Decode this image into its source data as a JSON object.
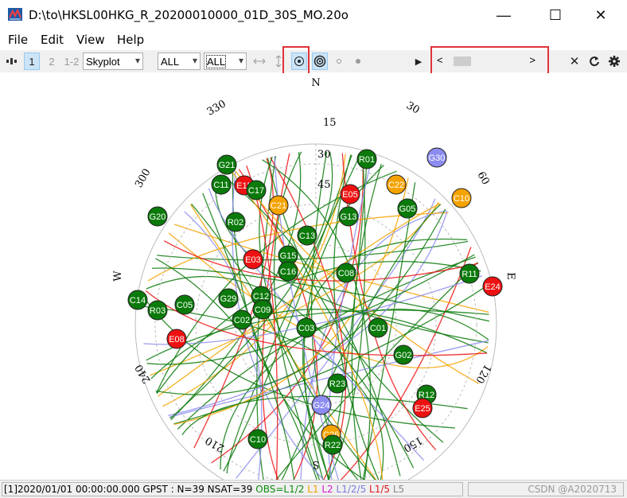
{
  "window": {
    "title": "D:\\to\\HKSL00HKG_R_20200010000_01D_30S_MO.20o",
    "minimize": "—",
    "maximize": "☐",
    "close": "✕"
  },
  "menu": [
    "File",
    "Edit",
    "View",
    "Help"
  ],
  "toolbar": {
    "btn1": "1",
    "btn2": "2",
    "btn12": "1-2",
    "plot_type": "Skyplot",
    "sys_filter": "ALL",
    "sat_filter": "ALL",
    "play": "▶",
    "close": "✕"
  },
  "timeline": {
    "prev": "<",
    "next": ">",
    "position": 0.12
  },
  "skyplot": {
    "compass": {
      "N": "N",
      "E": "E",
      "S": "S",
      "W": "W"
    },
    "elev_labels": [
      "15",
      "30",
      "45"
    ],
    "az_labels": [
      "30",
      "60",
      "120",
      "150",
      "210",
      "240",
      "300",
      "330"
    ],
    "satellites": [
      {
        "id": "G21",
        "color": "green"
      },
      {
        "id": "R01",
        "color": "green"
      },
      {
        "id": "G30",
        "color": "blue"
      },
      {
        "id": "C11",
        "color": "green"
      },
      {
        "id": "E15",
        "color": "red"
      },
      {
        "id": "C22",
        "color": "orange"
      },
      {
        "id": "C10",
        "color": "orange"
      },
      {
        "id": "C17",
        "color": "green"
      },
      {
        "id": "E05",
        "color": "red"
      },
      {
        "id": "G05",
        "color": "green"
      },
      {
        "id": "G20",
        "color": "green"
      },
      {
        "id": "C21",
        "color": "orange"
      },
      {
        "id": "G13",
        "color": "green"
      },
      {
        "id": "R02",
        "color": "green"
      },
      {
        "id": "C13",
        "color": "green"
      },
      {
        "id": "E03",
        "color": "red"
      },
      {
        "id": "G15",
        "color": "green"
      },
      {
        "id": "C16",
        "color": "green"
      },
      {
        "id": "C08",
        "color": "green"
      },
      {
        "id": "R11",
        "color": "green"
      },
      {
        "id": "E24",
        "color": "red"
      },
      {
        "id": "C14",
        "color": "green"
      },
      {
        "id": "G29",
        "color": "green"
      },
      {
        "id": "C12",
        "color": "green"
      },
      {
        "id": "R03",
        "color": "green"
      },
      {
        "id": "C05",
        "color": "green"
      },
      {
        "id": "C02",
        "color": "green"
      },
      {
        "id": "C09",
        "color": "green"
      },
      {
        "id": "C03",
        "color": "green"
      },
      {
        "id": "C01",
        "color": "green"
      },
      {
        "id": "E08",
        "color": "red"
      },
      {
        "id": "G02",
        "color": "green"
      },
      {
        "id": "R23",
        "color": "green"
      },
      {
        "id": "R12",
        "color": "green"
      },
      {
        "id": "G24",
        "color": "blue"
      },
      {
        "id": "E25",
        "color": "red"
      },
      {
        "id": "C10",
        "color": "green"
      },
      {
        "id": "C26",
        "color": "orange"
      },
      {
        "id": "R22",
        "color": "green"
      }
    ]
  },
  "colors": {
    "green": "#0a7a0a",
    "red": "#ee1111",
    "orange": "#f5a300",
    "blue": "#8c8cf0",
    "axis": "#999999"
  },
  "status": {
    "main": "[1]2020/01/01 00:00:00.000 GPST : N=39 NSAT=39",
    "obs": "OBS=L1/2",
    "l1": "L1",
    "l2": "L2",
    "l125": "L1/2/5",
    "l15": "L1/5",
    "l5": "L5",
    "watermark": "CSDN @A2020713"
  }
}
